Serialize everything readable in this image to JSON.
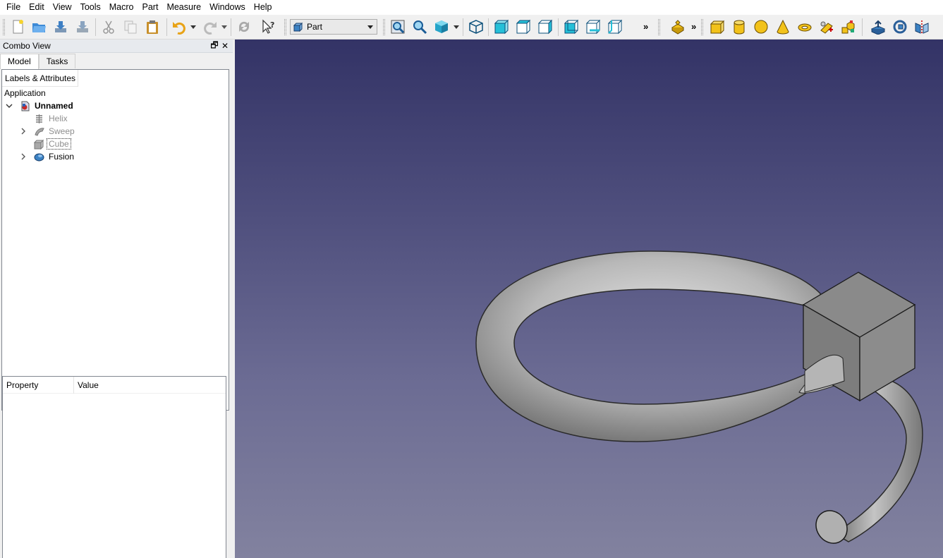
{
  "menubar": {
    "items": [
      "File",
      "Edit",
      "View",
      "Tools",
      "Macro",
      "Part",
      "Measure",
      "Windows",
      "Help"
    ]
  },
  "toolbar": {
    "workbench_selected": "Part",
    "overflow_glyph": "»",
    "icons": {
      "file": [
        "new-document-icon",
        "open-folder-icon",
        "save-icon",
        "save-as-icon"
      ],
      "edit": [
        "cut-icon",
        "copy-icon",
        "paste-icon",
        "undo-icon",
        "redo-icon",
        "refresh-icon",
        "whats-this-icon"
      ],
      "view": [
        "fit-all-icon",
        "fit-selection-icon",
        "draw-style-icon",
        "axonometric-view-icon",
        "front-view-icon",
        "top-view-icon",
        "right-view-icon",
        "rear-view-icon",
        "bottom-view-icon",
        "left-view-icon"
      ],
      "part": [
        "part-tools-icon",
        "box-icon",
        "cylinder-icon",
        "sphere-icon",
        "cone-icon",
        "torus-icon",
        "tube-icon",
        "primitives-icon",
        "extrude-icon",
        "revolve-icon",
        "mirror-icon"
      ]
    }
  },
  "combo_view": {
    "title": "Combo View",
    "float_glyph": "🗗",
    "close_glyph": "✕",
    "tabs": [
      {
        "label": "Model",
        "active": true
      },
      {
        "label": "Tasks",
        "active": false
      }
    ],
    "tree": {
      "header": "Labels & Attributes",
      "section": "Application",
      "document": "Unnamed",
      "items": [
        {
          "label": "Helix",
          "icon": "helix-icon",
          "expandable": false,
          "hidden": true
        },
        {
          "label": "Sweep",
          "icon": "sweep-icon",
          "expandable": true,
          "hidden": true
        },
        {
          "label": "Cube",
          "icon": "cube-icon",
          "expandable": false,
          "hidden": true,
          "focused": true
        },
        {
          "label": "Fusion",
          "icon": "fusion-icon",
          "expandable": true,
          "hidden": false
        }
      ]
    },
    "properties": {
      "columns": [
        "Property",
        "Value"
      ]
    }
  },
  "colors": {
    "view_top": "#333366",
    "view_bottom": "#82829f",
    "accent_cyan": "#25c0d8",
    "part_yellow": "#f2c21a"
  }
}
